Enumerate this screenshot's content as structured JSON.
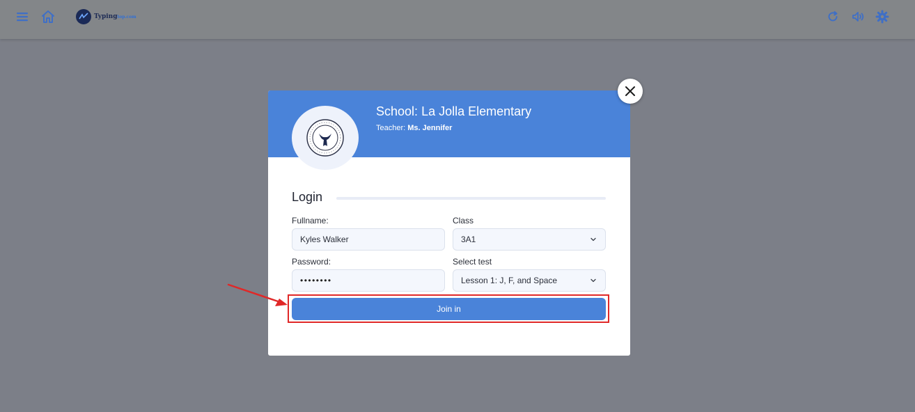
{
  "topbar": {
    "logo_text": "Typing",
    "logo_accent": "top",
    "logo_suffix": ".com"
  },
  "modal": {
    "school_prefix": "School:",
    "school_name": "La Jolla Elementary",
    "teacher_prefix": "Teacher:",
    "teacher_name": "Ms. Jennifer",
    "section_title": "Login",
    "fullname_label": "Fullname:",
    "fullname_value": "Kyles Walker",
    "class_label": "Class",
    "class_value": "3A1",
    "password_label": "Password:",
    "password_value": "••••••••",
    "test_label": "Select test",
    "test_value": "Lesson 1: J, F, and Space",
    "join_label": "Join in"
  },
  "colors": {
    "accent": "#4a83d9",
    "overlay": "#7c7f88",
    "highlight": "#e02828"
  },
  "icons": [
    "menu-icon",
    "home-icon",
    "refresh-icon",
    "volume-icon",
    "gear-icon",
    "close-icon",
    "chevron-down-icon"
  ]
}
